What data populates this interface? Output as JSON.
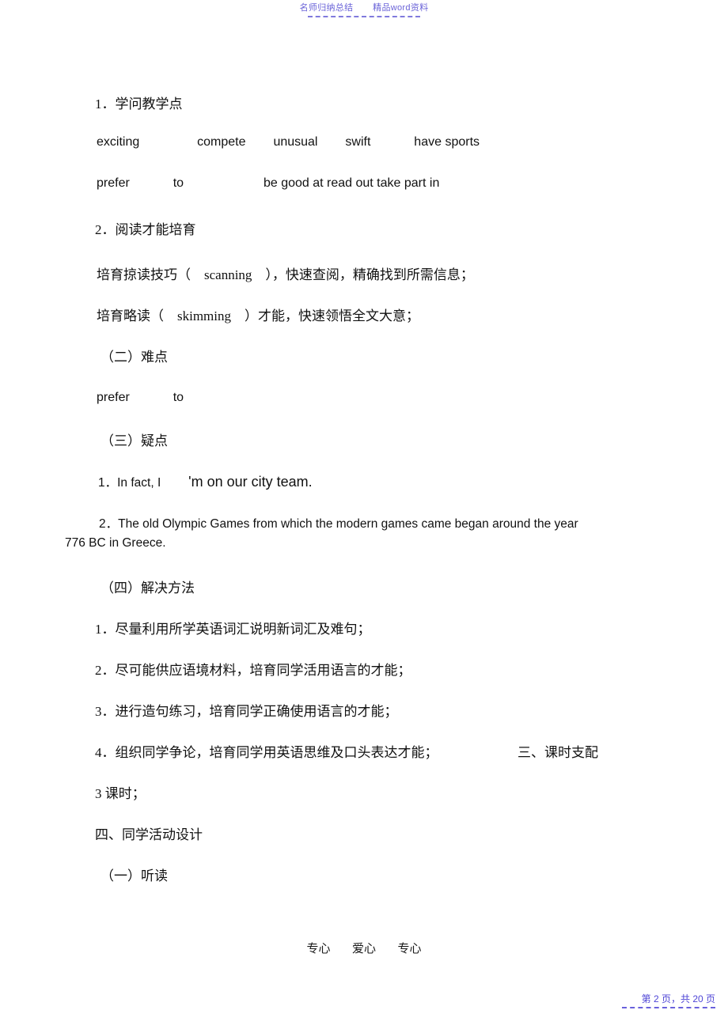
{
  "header": {
    "left_text": "名师归纳总结",
    "right_text": "精品word资料"
  },
  "footer": {
    "item1": "专心",
    "item2": "爱心",
    "item3": "专心",
    "page_indicator": "第 2 页，共 20 页"
  },
  "colors": {
    "watermark": "#6a63d8",
    "page_number": "#4f46d6",
    "body_text": "#111111",
    "background": "#ffffff"
  },
  "body": {
    "lines": [
      {
        "id": "l1",
        "text": "1．学问教学点"
      },
      {
        "id": "l2a",
        "text": "exciting"
      },
      {
        "id": "l2b",
        "text": "compete"
      },
      {
        "id": "l2c",
        "text": "unusual"
      },
      {
        "id": "l2d",
        "text": "swift"
      },
      {
        "id": "l2e",
        "text": "have sports"
      },
      {
        "id": "l3a",
        "text": "prefer"
      },
      {
        "id": "l3b",
        "text": "to"
      },
      {
        "id": "l3c",
        "text": "be good at read out take part in"
      },
      {
        "id": "l4",
        "text": "2．阅读才能培育"
      },
      {
        "id": "l5",
        "text": "培育掠读技巧（　scanning　），快速查阅，精确找到所需信息；"
      },
      {
        "id": "l6",
        "text": "培育略读（　skimming　）才能，快速领悟全文大意；"
      },
      {
        "id": "l7",
        "text": "（二）难点"
      },
      {
        "id": "l8a",
        "text": "prefer"
      },
      {
        "id": "l8b",
        "text": "to"
      },
      {
        "id": "l9",
        "text": "（三）疑点"
      },
      {
        "id": "l10a",
        "text": "1．In fact, I"
      },
      {
        "id": "l10b",
        "text": "'m on our city team."
      },
      {
        "id": "l11a",
        "text": "2．The old Olympic Games from which the modern games came began around the year"
      },
      {
        "id": "l11b",
        "text": "776 BC in Greece."
      },
      {
        "id": "l12",
        "text": "（四）解决方法"
      },
      {
        "id": "l13",
        "text": "1．尽量利用所学英语词汇说明新词汇及难句；"
      },
      {
        "id": "l14",
        "text": "2．尽可能供应语境材料，培育同学活用语言的才能；"
      },
      {
        "id": "l15",
        "text": "3．进行造句练习，培育同学正确使用语言的才能；"
      },
      {
        "id": "l16a",
        "text": "4．组织同学争论，培育同学用英语思维及口头表达才能；"
      },
      {
        "id": "l16b",
        "text": "三、课时支配"
      },
      {
        "id": "l17",
        "text": "3 课时；"
      },
      {
        "id": "l18",
        "text": "四、同学活动设计"
      },
      {
        "id": "l19",
        "text": "（一）听读"
      }
    ]
  }
}
